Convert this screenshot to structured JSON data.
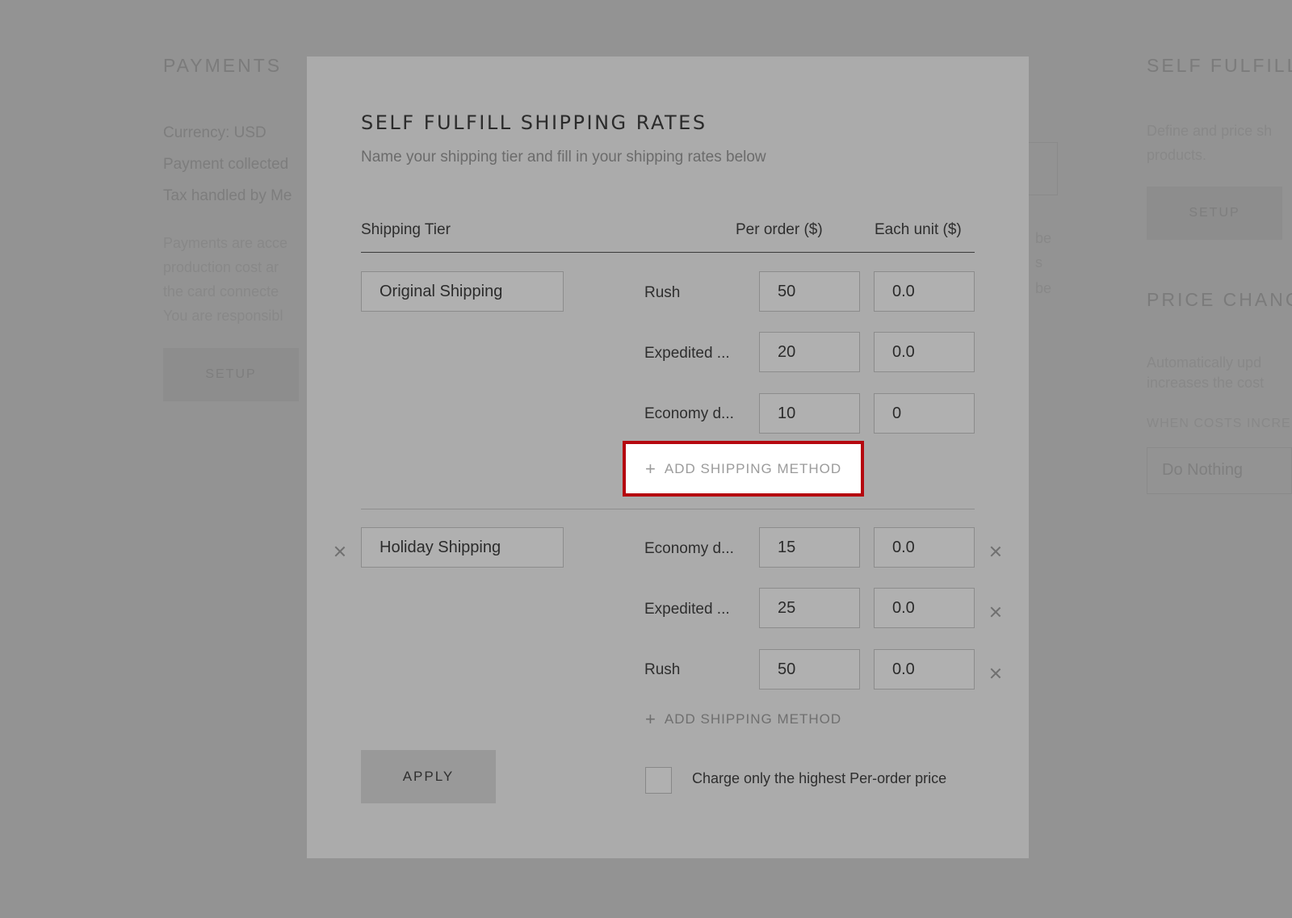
{
  "background": {
    "payments": {
      "heading": "PAYMENTS",
      "currency": "Currency: USD",
      "collected": "Payment collected",
      "tax": "Tax handled by Me",
      "para": [
        "Payments are acce",
        "production cost ar",
        "the card connecte",
        "You are responsibl"
      ],
      "setup": "SETUP"
    },
    "self_fulfill": {
      "heading": "SELF FULFILL S",
      "para": [
        "Define and price sh",
        "products."
      ],
      "setup": "SETUP"
    },
    "price_change": {
      "heading": "PRICE CHANGE",
      "para": [
        "Automatically upd",
        "increases the cost"
      ],
      "label": "WHEN COSTS INCRE",
      "select_value": "Do Nothing"
    },
    "side_text": [
      "be",
      "s",
      "be"
    ]
  },
  "modal": {
    "title": "SELF FULFILL SHIPPING RATES",
    "subtitle": "Name your shipping tier and fill in your shipping rates below",
    "columns": {
      "tier": "Shipping Tier",
      "per_order": "Per order ($)",
      "each_unit": "Each unit ($)"
    },
    "tiers": [
      {
        "name": "Original Shipping",
        "methods": [
          {
            "label": "Rush",
            "per_order": "50",
            "each_unit": "0.0"
          },
          {
            "label": "Expedited ...",
            "per_order": "20",
            "each_unit": "0.0"
          },
          {
            "label": "Economy d...",
            "per_order": "10",
            "each_unit": "0"
          }
        ],
        "add_label": "ADD SHIPPING METHOD"
      },
      {
        "name": "Holiday Shipping",
        "methods": [
          {
            "label": "Economy d...",
            "per_order": "15",
            "each_unit": "0.0"
          },
          {
            "label": "Expedited ...",
            "per_order": "25",
            "each_unit": "0.0"
          },
          {
            "label": "Rush",
            "per_order": "50",
            "each_unit": "0.0"
          }
        ],
        "add_label": "ADD SHIPPING METHOD"
      }
    ],
    "apply_label": "APPLY",
    "checkbox_label": "Charge only the highest Per-order price",
    "highlight_color": "#b5070f"
  }
}
